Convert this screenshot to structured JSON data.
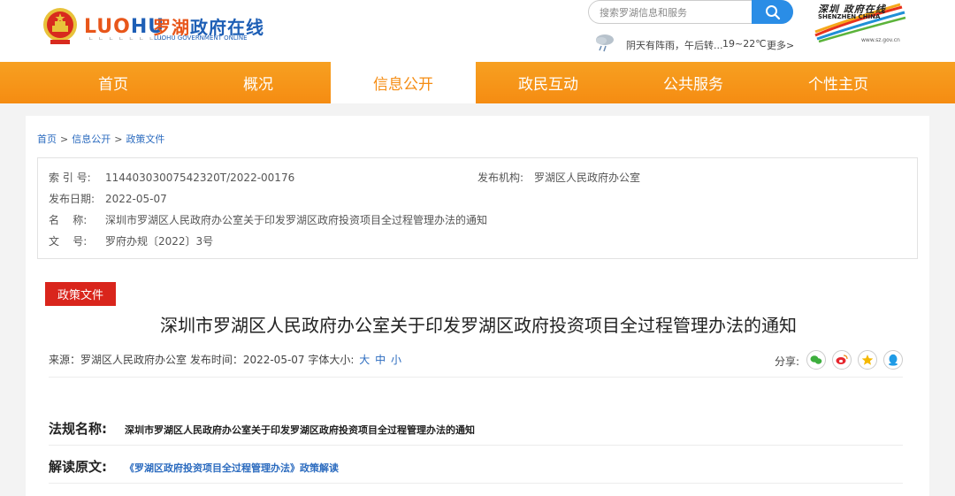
{
  "header": {
    "logo_en_a": "LUO",
    "logo_en_b": "HU",
    "logo_cn_a": "罗湖",
    "logo_cn_b": "政府在线",
    "logo_sub1": "ㄴ ㄴ ㄴ ㄴ  ㄴ ㄴ ㄴ ㄴ",
    "logo_sub2": "LUOHU GOVERNMENT ONLINE",
    "search_placeholder": "搜索罗湖信息和服务",
    "weather_text": "阴天有阵雨，午后转...",
    "weather_temp": "19~22℃",
    "weather_more": "更多>",
    "sz_cn": "深圳 政府在线",
    "sz_en": "SHENZHEN CHINA",
    "sz_url": "www.sz.gov.cn"
  },
  "nav": {
    "items": [
      "首页",
      "概况",
      "信息公开",
      "政民互动",
      "公共服务",
      "个性主页"
    ],
    "active_index": 2
  },
  "breadcrumb": [
    "首页",
    "信息公开",
    "政策文件"
  ],
  "meta": {
    "index_label": "索 引 号:",
    "index_value": "11440303007542320T/2022-00176",
    "org_label": "发布机构:",
    "org_value": "罗湖区人民政府办公室",
    "date_label": "发布日期:",
    "date_value": "2022-05-07",
    "name_label": "名    称:",
    "name_value": "深圳市罗湖区人民政府办公室关于印发罗湖区政府投资项目全过程管理办法的通知",
    "doc_label": "文    号:",
    "doc_value": "罗府办规〔2022〕3号"
  },
  "article": {
    "tag": "政策文件",
    "title": "深圳市罗湖区人民政府办公室关于印发罗湖区政府投资项目全过程管理办法的通知",
    "info": "来源：罗湖区人民政府办公室  发布时间：2022-05-07 字体大小:",
    "font_large": "大",
    "font_mid": "中",
    "font_small": "小",
    "share_label": "分享:",
    "law_label": "法规名称:",
    "law_value": "深圳市罗湖区人民政府办公室关于印发罗湖区政府投资项目全过程管理办法的通知",
    "interp_label": "解读原文:",
    "interp_value": "《罗湖区政府投资项目全过程管理办法》政策解读"
  },
  "colors": {
    "nav_orange": "#f58c12",
    "tag_red": "#d9251c",
    "link_blue": "#2b6bbf",
    "search_blue": "#2a8de6"
  }
}
